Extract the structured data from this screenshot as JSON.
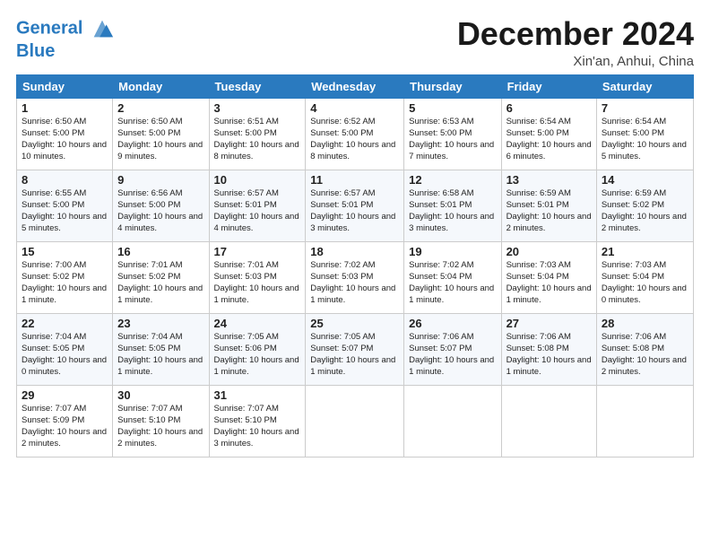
{
  "header": {
    "logo_line1": "General",
    "logo_line2": "Blue",
    "month_title": "December 2024",
    "location": "Xin'an, Anhui, China"
  },
  "weekdays": [
    "Sunday",
    "Monday",
    "Tuesday",
    "Wednesday",
    "Thursday",
    "Friday",
    "Saturday"
  ],
  "weeks": [
    [
      {
        "day": "1",
        "sunrise": "Sunrise: 6:50 AM",
        "sunset": "Sunset: 5:00 PM",
        "daylight": "Daylight: 10 hours and 10 minutes."
      },
      {
        "day": "2",
        "sunrise": "Sunrise: 6:50 AM",
        "sunset": "Sunset: 5:00 PM",
        "daylight": "Daylight: 10 hours and 9 minutes."
      },
      {
        "day": "3",
        "sunrise": "Sunrise: 6:51 AM",
        "sunset": "Sunset: 5:00 PM",
        "daylight": "Daylight: 10 hours and 8 minutes."
      },
      {
        "day": "4",
        "sunrise": "Sunrise: 6:52 AM",
        "sunset": "Sunset: 5:00 PM",
        "daylight": "Daylight: 10 hours and 8 minutes."
      },
      {
        "day": "5",
        "sunrise": "Sunrise: 6:53 AM",
        "sunset": "Sunset: 5:00 PM",
        "daylight": "Daylight: 10 hours and 7 minutes."
      },
      {
        "day": "6",
        "sunrise": "Sunrise: 6:54 AM",
        "sunset": "Sunset: 5:00 PM",
        "daylight": "Daylight: 10 hours and 6 minutes."
      },
      {
        "day": "7",
        "sunrise": "Sunrise: 6:54 AM",
        "sunset": "Sunset: 5:00 PM",
        "daylight": "Daylight: 10 hours and 5 minutes."
      }
    ],
    [
      {
        "day": "8",
        "sunrise": "Sunrise: 6:55 AM",
        "sunset": "Sunset: 5:00 PM",
        "daylight": "Daylight: 10 hours and 5 minutes."
      },
      {
        "day": "9",
        "sunrise": "Sunrise: 6:56 AM",
        "sunset": "Sunset: 5:00 PM",
        "daylight": "Daylight: 10 hours and 4 minutes."
      },
      {
        "day": "10",
        "sunrise": "Sunrise: 6:57 AM",
        "sunset": "Sunset: 5:01 PM",
        "daylight": "Daylight: 10 hours and 4 minutes."
      },
      {
        "day": "11",
        "sunrise": "Sunrise: 6:57 AM",
        "sunset": "Sunset: 5:01 PM",
        "daylight": "Daylight: 10 hours and 3 minutes."
      },
      {
        "day": "12",
        "sunrise": "Sunrise: 6:58 AM",
        "sunset": "Sunset: 5:01 PM",
        "daylight": "Daylight: 10 hours and 3 minutes."
      },
      {
        "day": "13",
        "sunrise": "Sunrise: 6:59 AM",
        "sunset": "Sunset: 5:01 PM",
        "daylight": "Daylight: 10 hours and 2 minutes."
      },
      {
        "day": "14",
        "sunrise": "Sunrise: 6:59 AM",
        "sunset": "Sunset: 5:02 PM",
        "daylight": "Daylight: 10 hours and 2 minutes."
      }
    ],
    [
      {
        "day": "15",
        "sunrise": "Sunrise: 7:00 AM",
        "sunset": "Sunset: 5:02 PM",
        "daylight": "Daylight: 10 hours and 1 minute."
      },
      {
        "day": "16",
        "sunrise": "Sunrise: 7:01 AM",
        "sunset": "Sunset: 5:02 PM",
        "daylight": "Daylight: 10 hours and 1 minute."
      },
      {
        "day": "17",
        "sunrise": "Sunrise: 7:01 AM",
        "sunset": "Sunset: 5:03 PM",
        "daylight": "Daylight: 10 hours and 1 minute."
      },
      {
        "day": "18",
        "sunrise": "Sunrise: 7:02 AM",
        "sunset": "Sunset: 5:03 PM",
        "daylight": "Daylight: 10 hours and 1 minute."
      },
      {
        "day": "19",
        "sunrise": "Sunrise: 7:02 AM",
        "sunset": "Sunset: 5:04 PM",
        "daylight": "Daylight: 10 hours and 1 minute."
      },
      {
        "day": "20",
        "sunrise": "Sunrise: 7:03 AM",
        "sunset": "Sunset: 5:04 PM",
        "daylight": "Daylight: 10 hours and 1 minute."
      },
      {
        "day": "21",
        "sunrise": "Sunrise: 7:03 AM",
        "sunset": "Sunset: 5:04 PM",
        "daylight": "Daylight: 10 hours and 0 minutes."
      }
    ],
    [
      {
        "day": "22",
        "sunrise": "Sunrise: 7:04 AM",
        "sunset": "Sunset: 5:05 PM",
        "daylight": "Daylight: 10 hours and 0 minutes."
      },
      {
        "day": "23",
        "sunrise": "Sunrise: 7:04 AM",
        "sunset": "Sunset: 5:05 PM",
        "daylight": "Daylight: 10 hours and 1 minute."
      },
      {
        "day": "24",
        "sunrise": "Sunrise: 7:05 AM",
        "sunset": "Sunset: 5:06 PM",
        "daylight": "Daylight: 10 hours and 1 minute."
      },
      {
        "day": "25",
        "sunrise": "Sunrise: 7:05 AM",
        "sunset": "Sunset: 5:07 PM",
        "daylight": "Daylight: 10 hours and 1 minute."
      },
      {
        "day": "26",
        "sunrise": "Sunrise: 7:06 AM",
        "sunset": "Sunset: 5:07 PM",
        "daylight": "Daylight: 10 hours and 1 minute."
      },
      {
        "day": "27",
        "sunrise": "Sunrise: 7:06 AM",
        "sunset": "Sunset: 5:08 PM",
        "daylight": "Daylight: 10 hours and 1 minute."
      },
      {
        "day": "28",
        "sunrise": "Sunrise: 7:06 AM",
        "sunset": "Sunset: 5:08 PM",
        "daylight": "Daylight: 10 hours and 2 minutes."
      }
    ],
    [
      {
        "day": "29",
        "sunrise": "Sunrise: 7:07 AM",
        "sunset": "Sunset: 5:09 PM",
        "daylight": "Daylight: 10 hours and 2 minutes."
      },
      {
        "day": "30",
        "sunrise": "Sunrise: 7:07 AM",
        "sunset": "Sunset: 5:10 PM",
        "daylight": "Daylight: 10 hours and 2 minutes."
      },
      {
        "day": "31",
        "sunrise": "Sunrise: 7:07 AM",
        "sunset": "Sunset: 5:10 PM",
        "daylight": "Daylight: 10 hours and 3 minutes."
      },
      null,
      null,
      null,
      null
    ]
  ]
}
